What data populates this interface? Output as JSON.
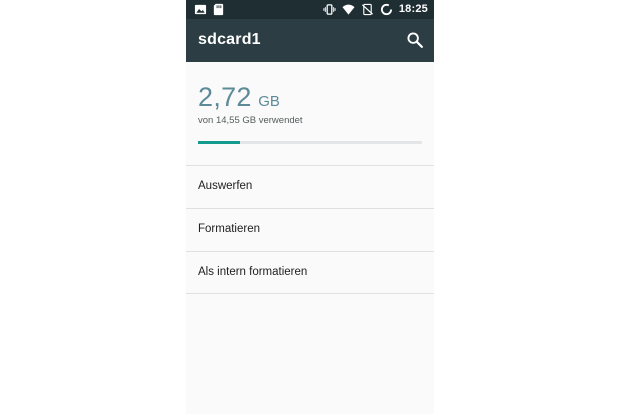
{
  "status_bar": {
    "time": "18:25",
    "icons_left": [
      "image-notification-icon",
      "sd-card-icon"
    ],
    "icons_right": [
      "vibrate-icon",
      "wifi-icon",
      "no-sim-icon",
      "sync-icon"
    ]
  },
  "toolbar": {
    "title": "sdcard1",
    "search_icon": "search-icon"
  },
  "storage": {
    "used_value": "2,72",
    "used_unit": "GB",
    "caption": "von 14,55 GB verwendet",
    "used_fraction": 0.187
  },
  "menu": [
    {
      "label": "Auswerfen"
    },
    {
      "label": "Formatieren"
    },
    {
      "label": "Als intern formatieren"
    }
  ],
  "colors": {
    "status_bar": "#1f2e33",
    "toolbar": "#2c3e43",
    "accent": "#139b8d",
    "storage_text": "#5c8a98"
  }
}
